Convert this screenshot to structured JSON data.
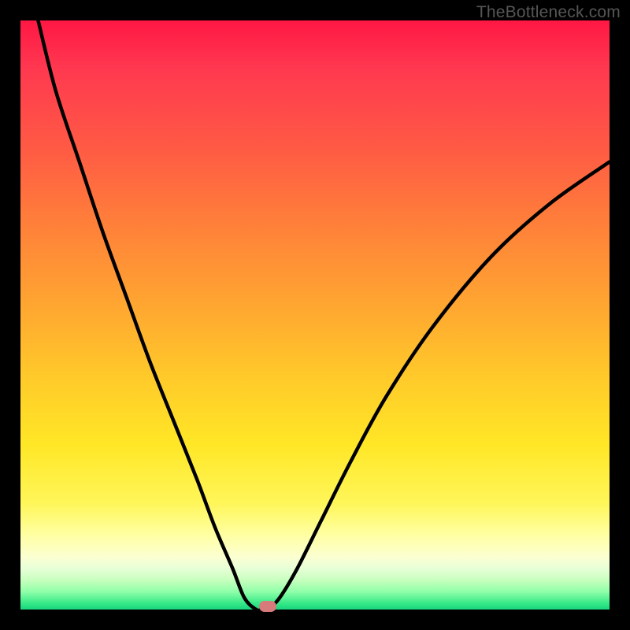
{
  "watermark": "TheBottleneck.com",
  "colors": {
    "background": "#000000",
    "gradient_top": "#ff1744",
    "gradient_bottom": "#18d47e",
    "curve": "#000000",
    "marker": "#d67a7c"
  },
  "chart_data": {
    "type": "line",
    "title": "",
    "xlabel": "",
    "ylabel": "",
    "xlim": [
      0,
      100
    ],
    "ylim": [
      0,
      100
    ],
    "series": [
      {
        "name": "bottleneck-curve",
        "x": [
          3,
          6,
          10,
          14,
          18,
          22,
          26,
          30,
          33,
          36,
          38,
          40,
          41,
          42,
          44,
          47,
          51,
          56,
          62,
          70,
          80,
          90,
          100
        ],
        "y": [
          100,
          88,
          76,
          64,
          53,
          42,
          32,
          22,
          14,
          7,
          2,
          0,
          0,
          0,
          2,
          7,
          15,
          25,
          36,
          48,
          60,
          69,
          76
        ]
      }
    ],
    "marker": {
      "x": 42,
      "y": 0
    }
  }
}
